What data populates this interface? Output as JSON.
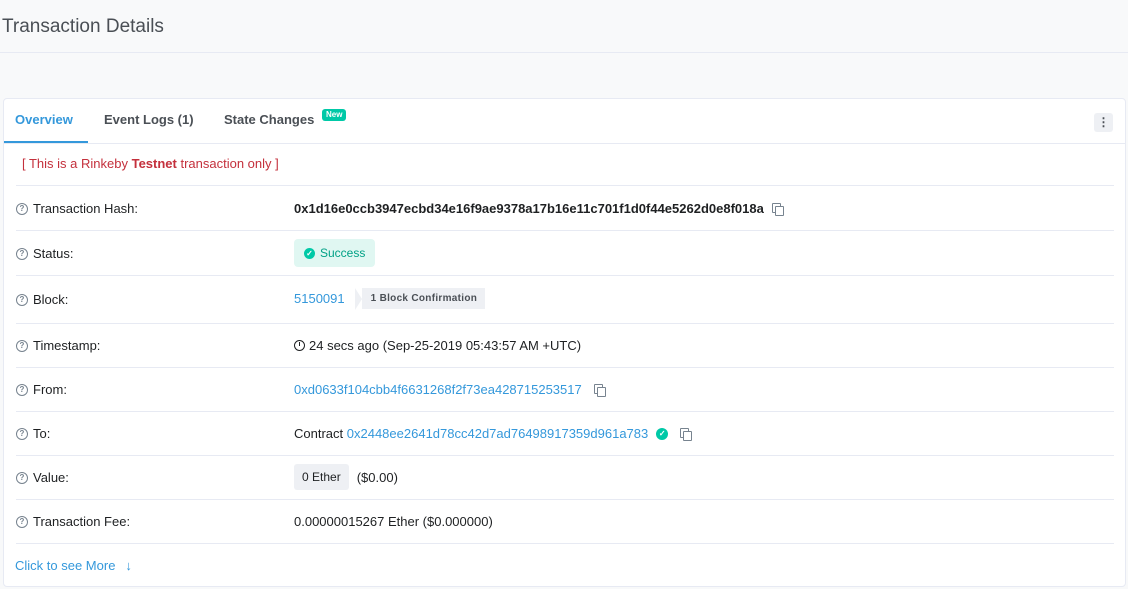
{
  "page": {
    "title": "Transaction Details"
  },
  "tabs": [
    {
      "label": "Overview",
      "active": true
    },
    {
      "label": "Event Logs (1)",
      "active": false
    },
    {
      "label": "State Changes",
      "active": false,
      "badge": "New"
    }
  ],
  "notice": {
    "prefix": "[ This is a Rinkeby ",
    "bold": "Testnet",
    "suffix": " transaction only ]"
  },
  "rows": {
    "hash": {
      "label": "Transaction Hash:",
      "value": "0x1d16e0ccb3947ecbd34e16f9ae9378a17b16e11c701f1d0f44e5262d0e8f018a"
    },
    "status": {
      "label": "Status:",
      "value": "Success"
    },
    "block": {
      "label": "Block:",
      "value": "5150091",
      "confirmations": "1 Block Confirmation"
    },
    "timestamp": {
      "label": "Timestamp:",
      "value": "24 secs ago (Sep-25-2019 05:43:57 AM +UTC)"
    },
    "from": {
      "label": "From:",
      "value": "0xd0633f104cbb4f6631268f2f73ea428715253517"
    },
    "to": {
      "label": "To:",
      "prefix": "Contract",
      "value": "0x2448ee2641d78cc42d7ad76498917359d961a783"
    },
    "value": {
      "label": "Value:",
      "ether": "0 Ether",
      "usd": "($0.00)"
    },
    "fee": {
      "label": "Transaction Fee:",
      "value": "0.00000015267 Ether ($0.000000)"
    }
  },
  "see_more": {
    "label": "Click to see More",
    "icon": "↓"
  },
  "colors": {
    "accent": "#3498db",
    "success": "#00c9a7",
    "notice": "#c4303c"
  }
}
